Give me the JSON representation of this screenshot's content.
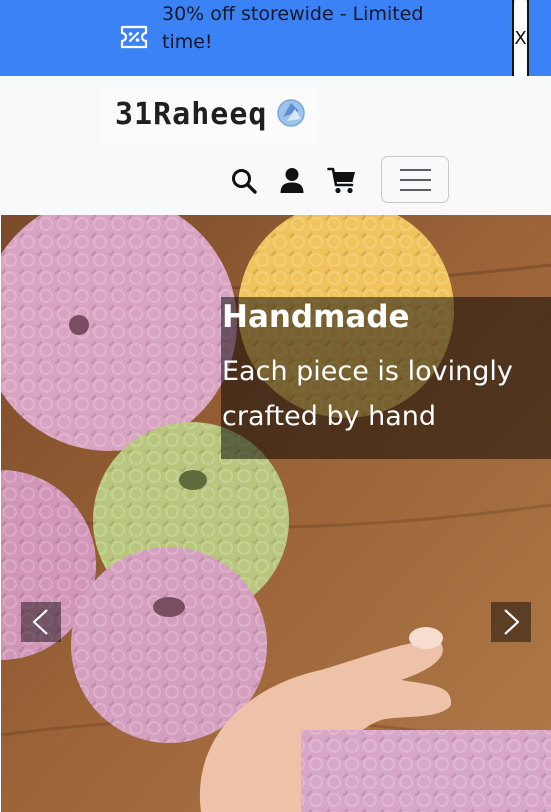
{
  "promo": {
    "text": "30% off storewide - Limited time!",
    "close_label": "X",
    "icon": "discount-ticket-icon"
  },
  "header": {
    "logo_text": "31Raheeq",
    "icons": [
      "search-icon",
      "user-icon",
      "cart-icon",
      "menu-icon"
    ]
  },
  "carousel": {
    "slide": {
      "title": "Handmade",
      "text": "Each piece is lovingly crafted by hand"
    },
    "prev_icon": "chevron-left-icon",
    "next_icon": "chevron-right-icon"
  },
  "colors": {
    "promo_bg": "#3b82f6",
    "header_bg": "#f8f9fa",
    "caption_bg": "rgba(0,0,0,0.5)"
  }
}
